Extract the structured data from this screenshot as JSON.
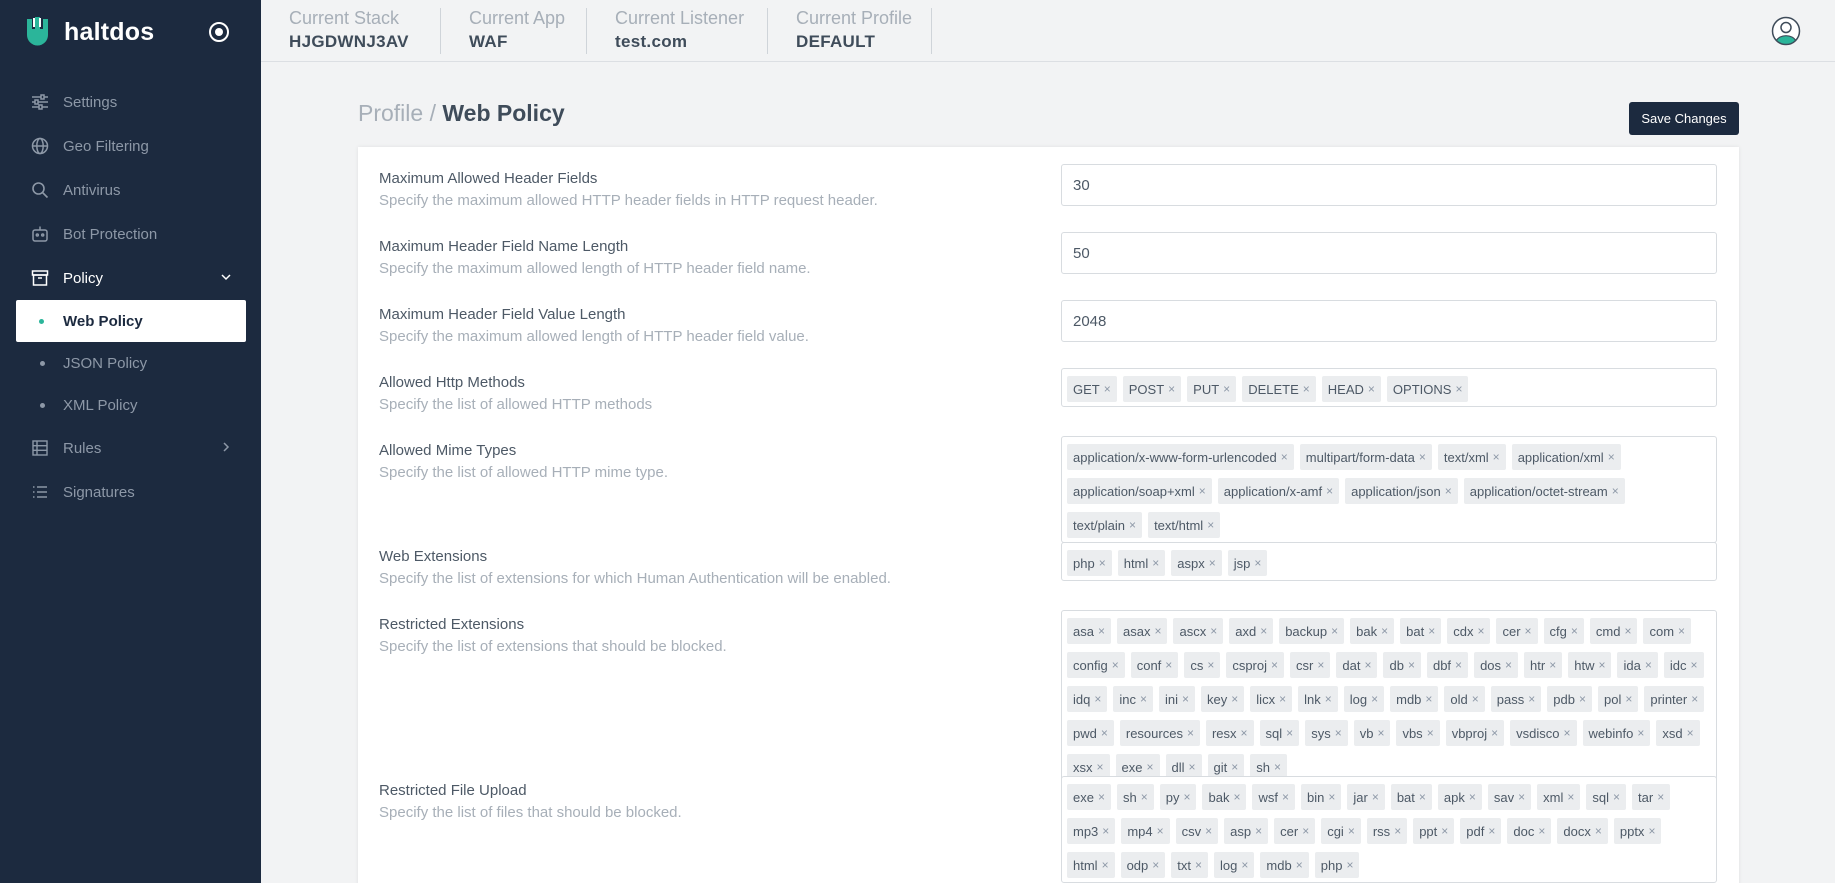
{
  "brand": {
    "name": "haltdos"
  },
  "sidebar": {
    "items": [
      {
        "label": "Settings",
        "icon": "sliders-icon"
      },
      {
        "label": "Geo Filtering",
        "icon": "globe-icon"
      },
      {
        "label": "Antivirus",
        "icon": "search-icon"
      },
      {
        "label": "Bot Protection",
        "icon": "robot-icon"
      },
      {
        "label": "Policy",
        "icon": "archive-icon",
        "open": true
      },
      {
        "label": "Rules",
        "icon": "list-grid-icon"
      },
      {
        "label": "Signatures",
        "icon": "list-icon"
      }
    ],
    "policy_sub": [
      {
        "label": "Web Policy",
        "active": true
      },
      {
        "label": "JSON Policy"
      },
      {
        "label": "XML Policy"
      }
    ]
  },
  "header": {
    "stack_label": "Current Stack",
    "stack_value": "HJGDWNJ3AV",
    "app_label": "Current App",
    "app_value": "WAF",
    "listener_label": "Current Listener",
    "listener_value": "test.com",
    "profile_label": "Current Profile",
    "profile_value": "DEFAULT"
  },
  "breadcrumb": {
    "parent": "Profile",
    "separator": " / ",
    "current": "Web Policy"
  },
  "toolbar": {
    "save_label": "Save Changes"
  },
  "settings": {
    "max_header_fields": {
      "label": "Maximum Allowed Header Fields",
      "desc": "Specify the maximum allowed HTTP header fields in HTTP request header.",
      "value": "30"
    },
    "max_name_length": {
      "label": "Maximum Header Field Name Length",
      "desc": "Specify the maximum allowed length of HTTP header field name.",
      "value": "50"
    },
    "max_value_length": {
      "label": "Maximum Header Field Value Length",
      "desc": "Specify the maximum allowed length of HTTP header field value.",
      "value": "2048"
    },
    "http_methods": {
      "label": "Allowed Http Methods",
      "desc": "Specify the list of allowed HTTP methods",
      "tags": [
        "GET",
        "POST",
        "PUT",
        "DELETE",
        "HEAD",
        "OPTIONS"
      ]
    },
    "mime_types": {
      "label": "Allowed Mime Types",
      "desc": "Specify the list of allowed HTTP mime type.",
      "tags": [
        "application/x-www-form-urlencoded",
        "multipart/form-data",
        "text/xml",
        "application/xml",
        "application/soap+xml",
        "application/x-amf",
        "application/json",
        "application/octet-stream",
        "text/plain",
        "text/html"
      ]
    },
    "web_extensions": {
      "label": "Web Extensions",
      "desc": "Specify the list of extensions for which Human Authentication will be enabled.",
      "tags": [
        "php",
        "html",
        "aspx",
        "jsp"
      ]
    },
    "restricted_extensions": {
      "label": "Restricted Extensions",
      "desc": "Specify the list of extensions that should be blocked.",
      "tags": [
        "asa",
        "asax",
        "ascx",
        "axd",
        "backup",
        "bak",
        "bat",
        "cdx",
        "cer",
        "cfg",
        "cmd",
        "com",
        "config",
        "conf",
        "cs",
        "csproj",
        "csr",
        "dat",
        "db",
        "dbf",
        "dos",
        "htr",
        "htw",
        "ida",
        "idc",
        "idq",
        "inc",
        "ini",
        "key",
        "licx",
        "lnk",
        "log",
        "mdb",
        "old",
        "pass",
        "pdb",
        "pol",
        "printer",
        "pwd",
        "resources",
        "resx",
        "sql",
        "sys",
        "vb",
        "vbs",
        "vbproj",
        "vsdisco",
        "webinfo",
        "xsd",
        "xsx",
        "exe",
        "dll",
        "git",
        "sh"
      ]
    },
    "restricted_uploads": {
      "label": "Restricted File Upload",
      "desc": "Specify the list of files that should be blocked.",
      "tags": [
        "exe",
        "sh",
        "py",
        "bak",
        "wsf",
        "bin",
        "jar",
        "bat",
        "apk",
        "sav",
        "xml",
        "sql",
        "tar",
        "mp3",
        "mp4",
        "csv",
        "asp",
        "cer",
        "cgi",
        "rss",
        "ppt",
        "pdf",
        "doc",
        "docx",
        "pptx",
        "html",
        "odp",
        "txt",
        "log",
        "mdb",
        "php"
      ]
    }
  }
}
